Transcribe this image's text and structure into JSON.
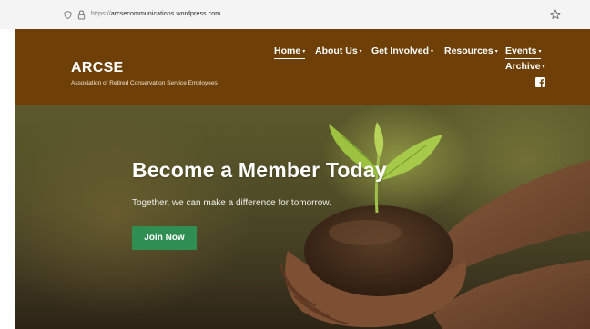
{
  "browser": {
    "url_prefix": "https://",
    "url_host": "arcsecommunications.wordpress.com",
    "icons": [
      "shield-icon",
      "lock-icon",
      "star-icon"
    ]
  },
  "header": {
    "title": "ARCSE",
    "tagline": "Association of Retired Conservation Service Employees",
    "background": "#6e4007"
  },
  "nav": {
    "items": [
      {
        "label": "Home",
        "active": true
      },
      {
        "label": "About Us",
        "active": false
      },
      {
        "label": "Get Involved",
        "active": false
      },
      {
        "label": "Resources",
        "active": false
      },
      {
        "label": "Events",
        "active": true
      },
      {
        "label": "Archive",
        "active": false
      }
    ],
    "caret": "▾",
    "social_icon": "facebook-icon"
  },
  "hero": {
    "headline": "Become a Member Today",
    "subtext": "Together, we can make a difference for tomorrow.",
    "button_label": "Join Now",
    "button_color": "#2f8f52"
  }
}
